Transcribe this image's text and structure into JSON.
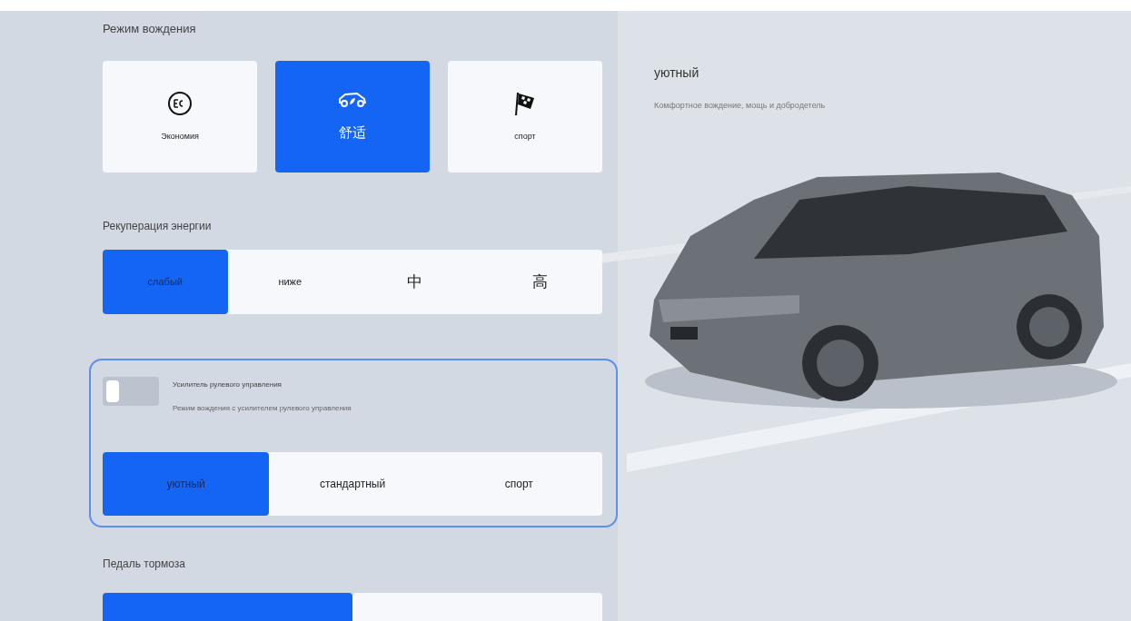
{
  "drive_mode": {
    "title": "Режим вождения",
    "options": [
      {
        "kind": "eco",
        "label": "Экономия",
        "selected": false
      },
      {
        "kind": "comfort",
        "label": "舒适",
        "selected": true
      },
      {
        "kind": "sport",
        "label": "спорт",
        "selected": false
      }
    ]
  },
  "mode_info": {
    "title": "уютный",
    "description": "Комфортное вождение, мощь и добродетель"
  },
  "regeneration": {
    "title": "Рекуперация энергии",
    "options": [
      {
        "label": "слабый",
        "selected": true
      },
      {
        "label": "ниже",
        "selected": false
      },
      {
        "label": "中",
        "selected": false
      },
      {
        "label": "高",
        "selected": false
      }
    ]
  },
  "steering": {
    "toggle": {
      "label": "Усилитель рулевого управления",
      "description": "Режим вождения с усилителем рулевого управления",
      "on": false
    },
    "options": [
      {
        "label": "уютный",
        "selected": true
      },
      {
        "label": "стандартный",
        "selected": false
      },
      {
        "label": "спорт",
        "selected": false
      }
    ]
  },
  "brake_pedal": {
    "title": "Педаль тормоза",
    "options": [
      {
        "selected": true
      },
      {
        "selected": false
      }
    ]
  }
}
